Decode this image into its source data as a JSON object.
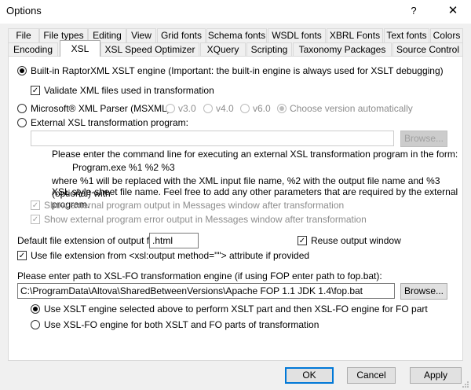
{
  "window": {
    "title": "Options",
    "help_glyph": "?",
    "close_glyph": "✕"
  },
  "tabs_row1": [
    "File",
    "File types",
    "Editing",
    "View",
    "Grid fonts",
    "Schema fonts",
    "WSDL fonts",
    "XBRL Fonts",
    "Text fonts",
    "Colors"
  ],
  "tabs_row2": [
    "Encoding",
    "XSL",
    "XSL Speed Optimizer",
    "XQuery",
    "Scripting",
    "Taxonomy Packages",
    "Source Control"
  ],
  "active_tab": "XSL",
  "xsl": {
    "builtin_label": "Built-in RaptorXML XSLT engine (Important: the built-in engine is always used for XSLT debugging)",
    "validate_label": "Validate XML files used in transformation",
    "msxml_label": "Microsoft® XML Parser (MSXML):",
    "v30": "v3.0",
    "v40": "v4.0",
    "v60": "v6.0",
    "auto": "Choose version automatically",
    "external_label": "External XSL transformation program:",
    "external_value": "",
    "browse": "Browse...",
    "cmd_intro": "Please enter the command line for executing an external XSL transformation program in the form:",
    "cmd_example": "Program.exe %1 %2 %3",
    "cmd_line1": "where %1 will be replaced with the XML input file name, %2 with the output file name and %3 (optional) with",
    "cmd_line2": "XSL style-sheet  file name. Feel free to add any other parameters that are required by the external program.",
    "show_output": "Show external program output in Messages window after transformation",
    "show_error": "Show external program error output in Messages window after transformation",
    "ext_label": "Default file extension of output file:",
    "ext_value": ".html",
    "reuse_label": "Reuse output window",
    "use_ext_label": "Use file extension from <xsl:output method=\"\"> attribute if provided",
    "fo_label": "Please enter path to XSL-FO transformation engine (if using FOP enter path to fop.bat):",
    "fo_value": "C:\\ProgramData\\Altova\\SharedBetweenVersions\\Apache FOP 1.1 JDK 1.4\\fop.bat",
    "fo_browse": "Browse...",
    "fo_opt1": "Use XSLT engine selected above to perform XSLT part and then XSL-FO engine for FO part",
    "fo_opt2": "Use XSL-FO engine for both XSLT and FO parts of transformation"
  },
  "buttons": {
    "ok": "OK",
    "cancel": "Cancel",
    "apply": "Apply"
  },
  "checkmark": "✓"
}
